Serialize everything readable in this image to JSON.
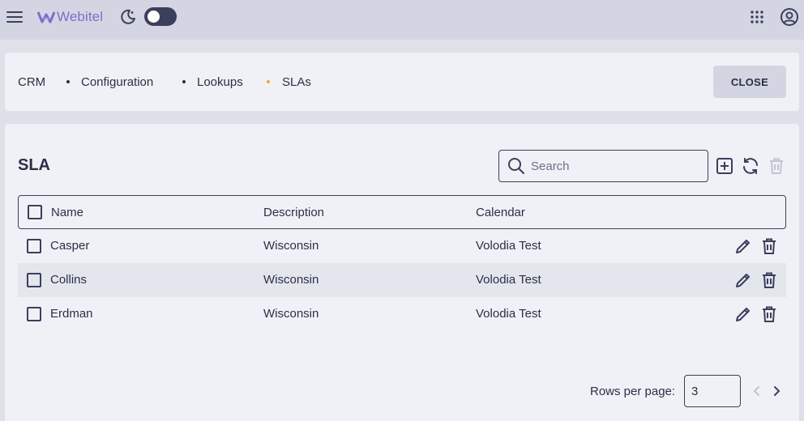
{
  "header": {
    "app_name": "Webitel",
    "brand_color": "#7b6fcc",
    "icons": [
      "menu-icon",
      "webitel-logo-icon",
      "moon-icon",
      "apps-grid-icon",
      "account-icon"
    ],
    "dark_mode": false
  },
  "breadcrumbs": {
    "items": [
      {
        "label": "CRM"
      },
      {
        "label": "Configuration"
      },
      {
        "label": "Lookups"
      },
      {
        "label": "SLAs"
      }
    ],
    "close_label": "CLOSE",
    "active_dot_color": "#f5a623"
  },
  "panel": {
    "title": "SLA",
    "search": {
      "placeholder": "Search",
      "value": ""
    },
    "actions": [
      "add-icon",
      "refresh-icon",
      "delete-icon"
    ]
  },
  "table": {
    "columns": [
      "Name",
      "Description",
      "Calendar"
    ],
    "rows": [
      {
        "name": "Casper",
        "description": "Wisconsin",
        "calendar": "Volodia Test"
      },
      {
        "name": "Collins",
        "description": "Wisconsin",
        "calendar": "Volodia Test"
      },
      {
        "name": "Erdman",
        "description": "Wisconsin",
        "calendar": "Volodia Test"
      }
    ]
  },
  "pagination": {
    "rows_per_page_label": "Rows per page:",
    "rows_per_page_value": "3"
  }
}
